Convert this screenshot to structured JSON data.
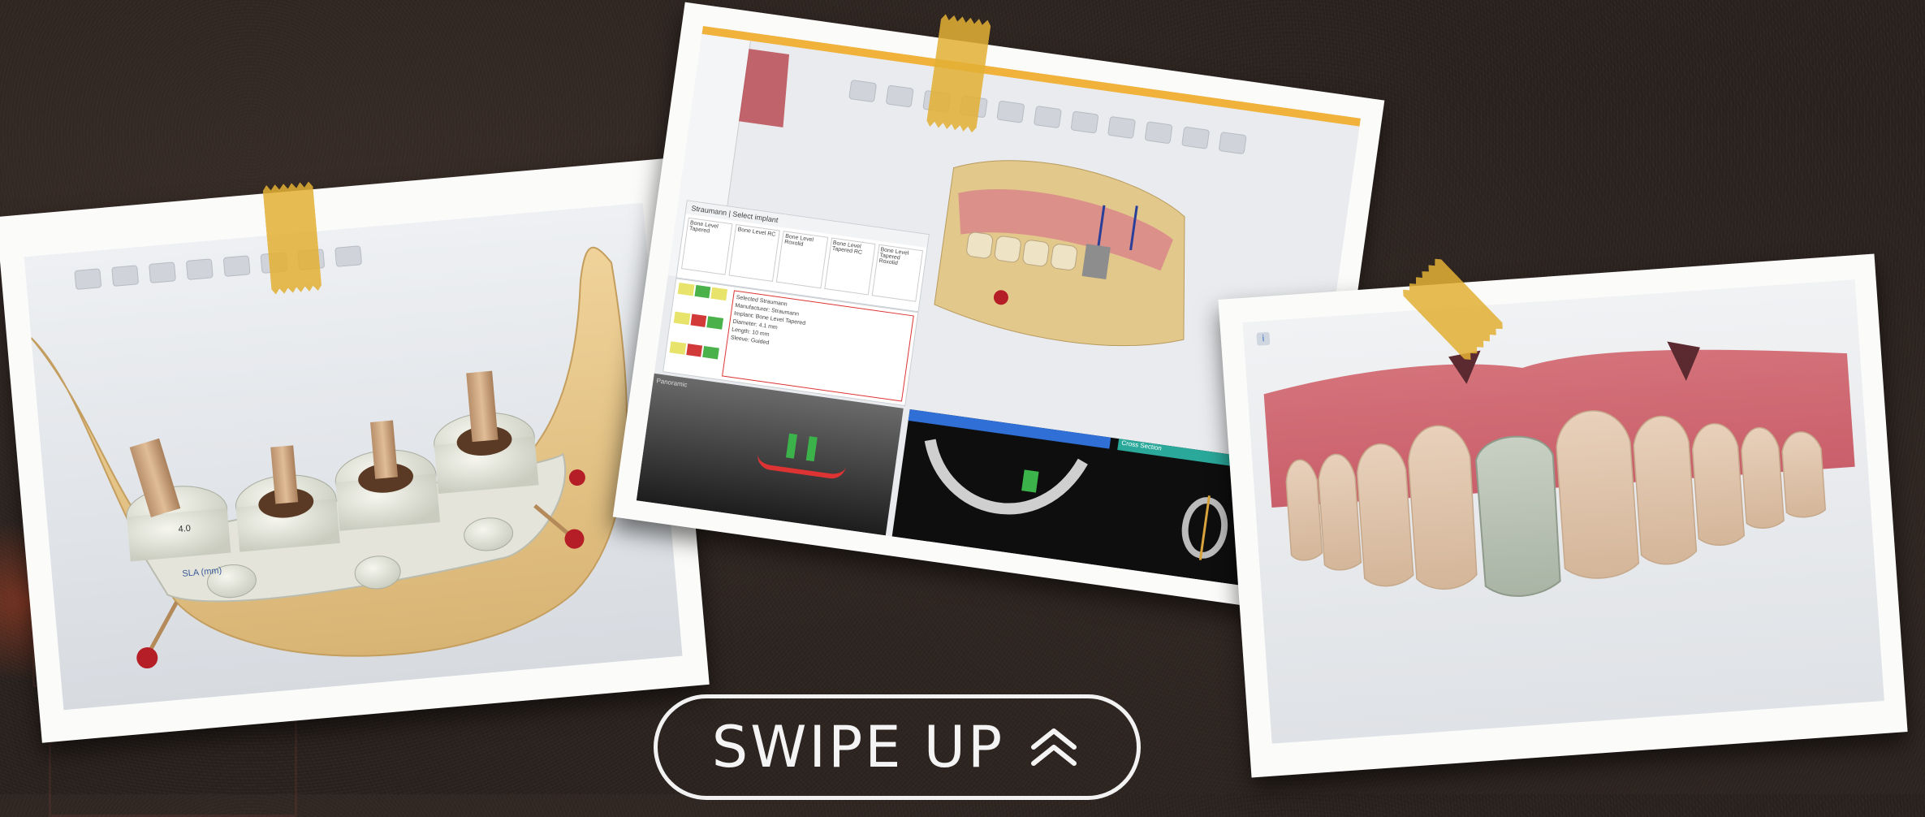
{
  "photo_1": {
    "labels": [
      "SLA (mm)",
      "4.0"
    ]
  },
  "photo_2": {
    "panel_title": "Straumann | Select implant",
    "implant_cards": [
      "Bone Level Tapered",
      "Bone Level RC",
      "Bone Level Roxolid",
      "Bone Level Tapered RC",
      "Bone Level Tapered Roxolid"
    ],
    "info_text": [
      "Selected Straumann",
      "Manufacturer: Straumann",
      "Implant: Bone Level Tapered",
      "Diameter: 4.1 mm",
      "Length: 10 mm",
      "Sleeve: Guided"
    ],
    "panel_tab": "Panoramic",
    "section_tab": "Cross Section",
    "colors": {
      "accent_bar": "#f0b23a",
      "section_header": "#2f6fd6",
      "teal_header": "#2aa99b"
    }
  },
  "photo_3": {},
  "swipe": {
    "label": "SWIPE UP",
    "icon": "double-chevron-up-icon"
  }
}
